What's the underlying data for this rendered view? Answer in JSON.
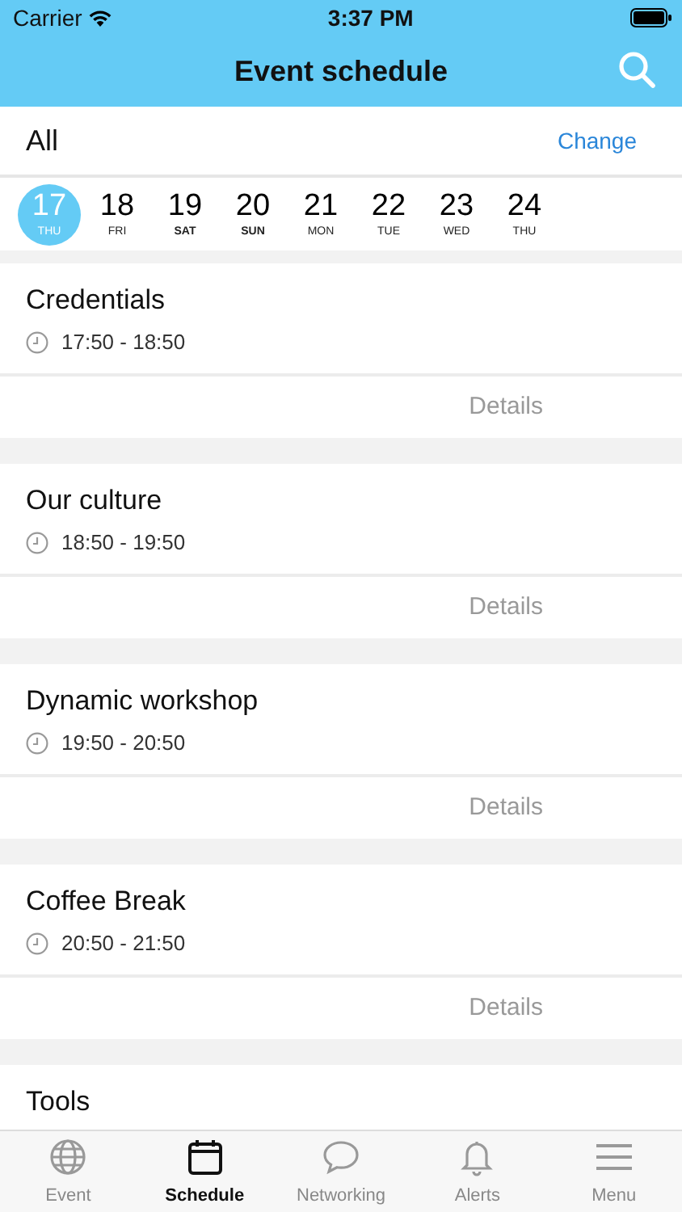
{
  "status_bar": {
    "carrier": "Carrier",
    "time": "3:37 PM"
  },
  "nav_bar": {
    "title": "Event schedule"
  },
  "filter": {
    "label": "All",
    "action": "Change"
  },
  "dates": [
    {
      "day": "17",
      "weekday": "THU",
      "selected": true,
      "kind": "weekday"
    },
    {
      "day": "18",
      "weekday": "FRI",
      "selected": false,
      "kind": "weekday"
    },
    {
      "day": "19",
      "weekday": "SAT",
      "selected": false,
      "kind": "weekend"
    },
    {
      "day": "20",
      "weekday": "SUN",
      "selected": false,
      "kind": "weekend"
    },
    {
      "day": "21",
      "weekday": "MON",
      "selected": false,
      "kind": "weekday"
    },
    {
      "day": "22",
      "weekday": "TUE",
      "selected": false,
      "kind": "weekday"
    },
    {
      "day": "23",
      "weekday": "WED",
      "selected": false,
      "kind": "weekday"
    },
    {
      "day": "24",
      "weekday": "THU",
      "selected": false,
      "kind": "weekday"
    }
  ],
  "events": [
    {
      "title": "Credentials",
      "time": "17:50 - 18:50",
      "action": "Details"
    },
    {
      "title": "Our culture",
      "time": "18:50 - 19:50",
      "action": "Details"
    },
    {
      "title": "Dynamic workshop",
      "time": "19:50 - 20:50",
      "action": "Details"
    },
    {
      "title": "Coffee Break",
      "time": "20:50 - 21:50",
      "action": "Details"
    },
    {
      "title": "Tools"
    }
  ],
  "tab_bar": [
    {
      "label": "Event",
      "kind": "globe",
      "selected": false
    },
    {
      "label": "Schedule",
      "kind": "calendar",
      "selected": true
    },
    {
      "label": "Networking",
      "kind": "chat",
      "selected": false
    },
    {
      "label": "Alerts",
      "kind": "bell",
      "selected": false
    },
    {
      "label": "Menu",
      "kind": "menu",
      "selected": false
    }
  ]
}
